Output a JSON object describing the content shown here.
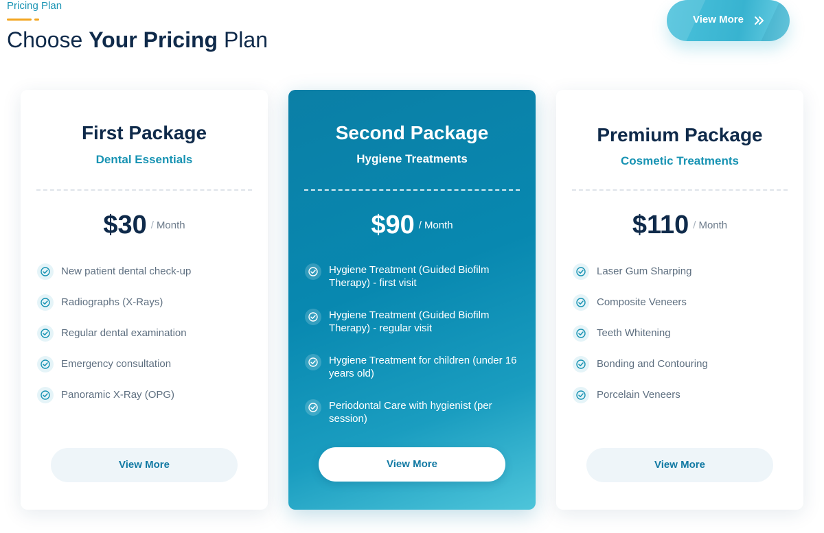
{
  "header": {
    "eyebrow": "Pricing Plan",
    "headline_pre": "Choose ",
    "headline_bold": "Your Pricing",
    "headline_post": " Plan",
    "view_more_label": "View More",
    "view_more_icon": "double-chevron-right-icon"
  },
  "plans": [
    {
      "title": "First Package",
      "subtitle": "Dental Essentials",
      "price": "$30",
      "slash": "/",
      "period": "Month",
      "features": [
        "New patient dental check-up",
        "Radiographs (X-Rays)",
        "Regular dental examination",
        "Emergency consultation",
        "Panoramic X-Ray (OPG)"
      ],
      "cta": "View More"
    },
    {
      "title": "Second Package",
      "subtitle": "Hygiene Treatments",
      "price": "$90",
      "slash": "/",
      "period": "Month",
      "features": [
        "Hygiene Treatment (Guided Biofilm Therapy) - first visit",
        "Hygiene Treatment (Guided Biofilm Therapy) - regular visit",
        "Hygiene Treatment for children (under 16 years old)",
        "Periodontal Care with hygienist (per session)"
      ],
      "cta": "View More"
    },
    {
      "title": "Premium Package",
      "subtitle": "Cosmetic Treatments",
      "price": "$110",
      "slash": "/",
      "period": "Month",
      "features": [
        "Laser Gum Sharping",
        "Composite Veneers",
        "Teeth Whitening",
        "Bonding and Contouring",
        "Porcelain Veneers"
      ],
      "cta": "View More"
    }
  ],
  "colors": {
    "accent_teal": "#1893b3",
    "eyebrow_bar": "#f3a51f",
    "navy_text": "#0f2a4a",
    "featured_card": "#0b7fa6"
  }
}
